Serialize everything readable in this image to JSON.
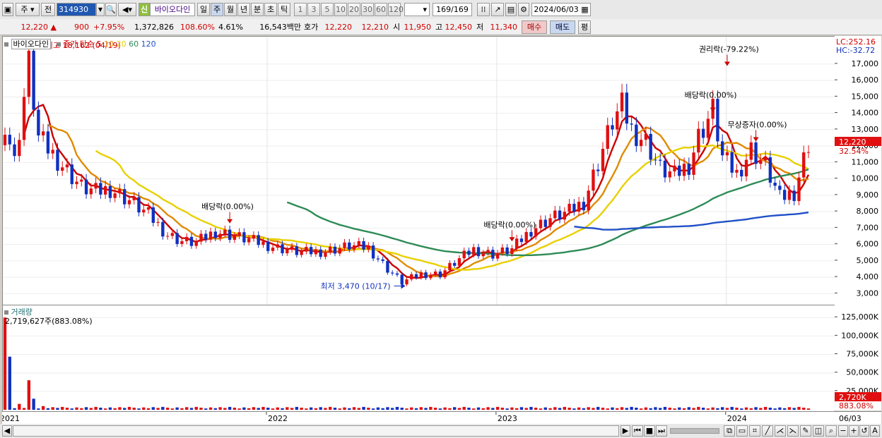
{
  "toolbar": {
    "type_select": "주",
    "range_select": "전",
    "code": "314930",
    "sin_badge": "신",
    "stock_name": "바이오다인",
    "periods": [
      "일",
      "주",
      "월",
      "년",
      "분",
      "초",
      "틱"
    ],
    "selected_period": "주",
    "intervals": [
      "1",
      "3",
      "5",
      "10",
      "20",
      "30",
      "60",
      "120"
    ],
    "count": "169",
    "count_total": "/169",
    "date": "2024/06/03"
  },
  "quote": {
    "price": "12,220",
    "change": "900",
    "change_pct": "+7.95%",
    "volume": "1,372,826",
    "volume_ratio": "108.60%",
    "turnover": "4.61%",
    "amount": "16,543백만",
    "hoga_label": "호가",
    "ask": "12,220",
    "bid": "12,210",
    "open_label": "시",
    "open": "11,950",
    "high_label": "고",
    "high": "12,450",
    "low_label": "저",
    "low": "11,340",
    "buy_label": "매수",
    "sell_label": "매도",
    "eval_label": "평"
  },
  "legend": {
    "name": "바이오다인",
    "ma_label": "종가 단순",
    "ma_periods": [
      "5",
      "10",
      "20",
      "60",
      "120"
    ],
    "ma_colors": [
      "#cc0000",
      "#e08a00",
      "#e8d000",
      "#2e8b57",
      "#2050c8"
    ]
  },
  "annotations": {
    "high": "최고 18,162 (04/19)",
    "low": "최저 3,470 (10/17)",
    "events": [
      "배당락(0.00%)",
      "배당락(0.00%)",
      "배당락(0.00%)",
      "권리락(-79.22%)",
      "무상증자(0.00%)"
    ]
  },
  "right_axis": {
    "lc": "LC:252.16",
    "hc": "HC:-32.72",
    "price_ticks": [
      "17,000",
      "16,000",
      "15,000",
      "14,000",
      "13,000",
      "12,000",
      "11,000",
      "10,000",
      "9,000",
      "8,000",
      "7,000",
      "6,000",
      "5,000",
      "4,000",
      "3,000"
    ],
    "current_price": "12,220",
    "current_pct": "32.54%",
    "volume_ticks": [
      "125,000K",
      "100,000K",
      "75,000K",
      "50,000K",
      "25,000K"
    ],
    "current_volume": "2,720K",
    "volume_pct": "883.08%"
  },
  "volume_panel": {
    "title": "거래량",
    "max_label": "2,719,627주(883.08%)"
  },
  "x_axis": {
    "labels": [
      "2021",
      "2022",
      "2023",
      "2024"
    ],
    "end_label": "06/03"
  },
  "chart_data": {
    "type": "candlestick",
    "price_ylim": [
      2500,
      18500
    ],
    "volume_ylim": [
      0,
      130000
    ],
    "weeks": 169,
    "ma_periods": [
      5,
      10,
      20,
      60,
      120
    ],
    "anchor_closes": [
      [
        0,
        13500
      ],
      [
        2,
        11000
      ],
      [
        5,
        17000
      ],
      [
        7,
        12500
      ],
      [
        10,
        11500
      ],
      [
        13,
        10500
      ],
      [
        16,
        9500
      ],
      [
        19,
        9200
      ],
      [
        22,
        9400
      ],
      [
        26,
        8700
      ],
      [
        30,
        7800
      ],
      [
        34,
        6600
      ],
      [
        37,
        6200
      ],
      [
        40,
        6100
      ],
      [
        44,
        6800
      ],
      [
        47,
        6600
      ],
      [
        52,
        6200
      ],
      [
        57,
        5800
      ],
      [
        62,
        5500
      ],
      [
        67,
        5600
      ],
      [
        72,
        5900
      ],
      [
        76,
        5800
      ],
      [
        80,
        4500
      ],
      [
        83,
        3700
      ],
      [
        87,
        4200
      ],
      [
        91,
        4200
      ],
      [
        95,
        5100
      ],
      [
        98,
        5700
      ],
      [
        102,
        5400
      ],
      [
        106,
        5700
      ],
      [
        110,
        6900
      ],
      [
        114,
        7600
      ],
      [
        118,
        8000
      ],
      [
        121,
        8600
      ],
      [
        124,
        11000
      ],
      [
        127,
        13500
      ],
      [
        129,
        14400
      ],
      [
        131,
        13000
      ],
      [
        134,
        12300
      ],
      [
        137,
        10600
      ],
      [
        140,
        10200
      ],
      [
        143,
        10900
      ],
      [
        145,
        12600
      ],
      [
        148,
        14200
      ],
      [
        150,
        11300
      ],
      [
        153,
        10300
      ],
      [
        156,
        11800
      ],
      [
        159,
        10800
      ],
      [
        162,
        8800
      ],
      [
        165,
        9200
      ],
      [
        168,
        12220
      ]
    ],
    "volumes_k": [
      [
        0,
        125000
      ],
      [
        1,
        72000
      ],
      [
        3,
        8000
      ],
      [
        5,
        40000
      ],
      [
        6,
        15000
      ],
      [
        8,
        5000
      ]
    ]
  }
}
